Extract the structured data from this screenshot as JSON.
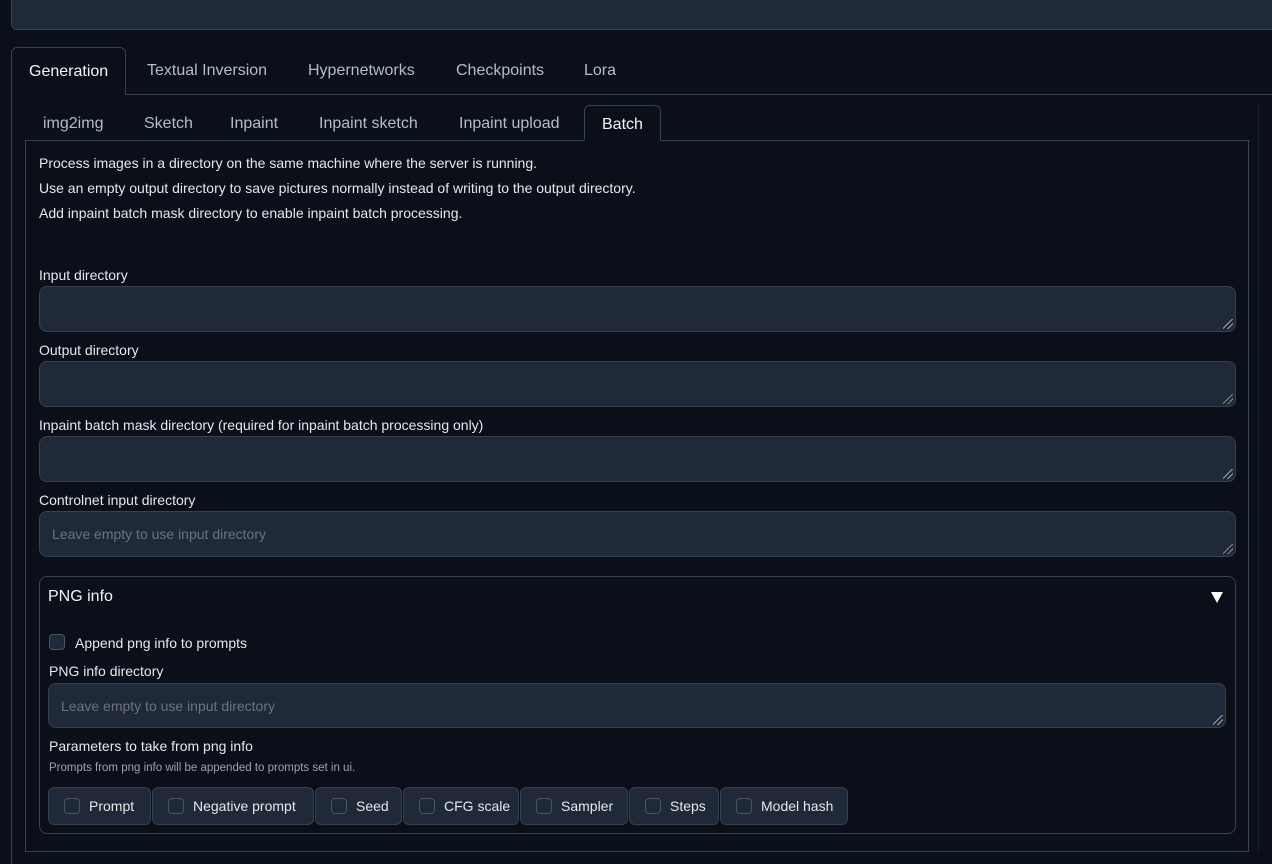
{
  "main_tabs": [
    "Generation",
    "Textual Inversion",
    "Hypernetworks",
    "Checkpoints",
    "Lora"
  ],
  "sub_tabs": [
    "img2img",
    "Sketch",
    "Inpaint",
    "Inpaint sketch",
    "Inpaint upload",
    "Batch"
  ],
  "info": [
    "Process images in a directory on the same machine where the server is running.",
    "Use an empty output directory to save pictures normally instead of writing to the output directory.",
    "Add inpaint batch mask directory to enable inpaint batch processing."
  ],
  "fields": {
    "input_dir": {
      "label": "Input directory",
      "value": ""
    },
    "output_dir": {
      "label": "Output directory",
      "value": ""
    },
    "mask_dir": {
      "label": "Inpaint batch mask directory (required for inpaint batch processing only)",
      "value": ""
    },
    "controlnet_dir": {
      "label": "Controlnet input directory",
      "placeholder": "Leave empty to use input directory"
    }
  },
  "png_info": {
    "title": "PNG info",
    "append_label": "Append png info to prompts",
    "dir_label": "PNG info directory",
    "dir_placeholder": "Leave empty to use input directory",
    "params_label": "Parameters to take from png info",
    "params_hint": "Prompts from png info will be appended to prompts set in ui.",
    "params": [
      "Prompt",
      "Negative prompt",
      "Seed",
      "CFG scale",
      "Sampler",
      "Steps",
      "Model hash"
    ]
  },
  "colors": {
    "background": "#0b0f19",
    "panel": "#1f2937",
    "border": "#374151"
  }
}
